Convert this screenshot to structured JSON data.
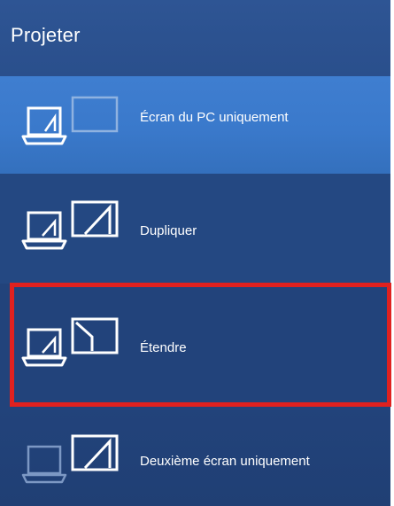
{
  "header": {
    "title": "Projeter"
  },
  "options": [
    {
      "label": "Écran du PC uniquement",
      "icon": "pc-screen-only-icon",
      "selected": true
    },
    {
      "label": "Dupliquer",
      "icon": "duplicate-icon",
      "selected": false
    },
    {
      "label": "Étendre",
      "icon": "extend-icon",
      "selected": false,
      "highlighted": true
    },
    {
      "label": "Deuxième écran uniquement",
      "icon": "second-screen-only-icon",
      "selected": false
    }
  ],
  "colors": {
    "header": "#2e5594",
    "selected": "#3a79cb",
    "background": "#22437b",
    "highlight": "#e0211f",
    "text": "#ffffff"
  }
}
